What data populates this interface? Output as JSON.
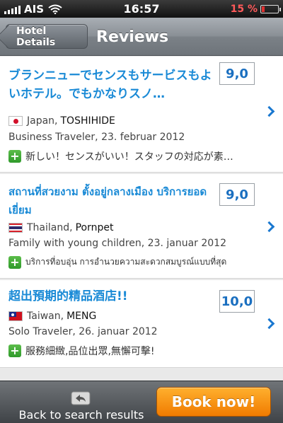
{
  "status_bar": {
    "carrier": "AIS",
    "time": "16:57",
    "battery_percent": "15 %",
    "battery_level": 0.15,
    "icons": [
      "signal-icon",
      "wifi-icon",
      "battery-icon"
    ]
  },
  "nav": {
    "back_label": "Hotel Details",
    "title": "Reviews"
  },
  "reviews": [
    {
      "title": "ブランニューでセンスもサービスもよいホテル。でもかなりスノ…",
      "score": "9,0",
      "country": "Japan,",
      "reviewer": "TOSHIHIDE",
      "flag_icon": "japan-flag-icon",
      "traveler": "Business Traveler, 23. februar 2012",
      "pro": "新しい！センスがいい！スタッフの対応が素…"
    },
    {
      "title": "สถานที่สวยงาม ตั้งอยู่กลางเมือง บริการยอดเยี่ยม",
      "score": "9,0",
      "country": "Thailand,",
      "reviewer": "Pornpet",
      "flag_icon": "thailand-flag-icon",
      "traveler": "Family with young children, 23. januar 2012",
      "pro": "บริการที่อบอุ่น การอำนวยความสะดวกสมบูรณ์แบบที่สุด"
    },
    {
      "title": "超出預期的精品酒店!!",
      "score": "10,0",
      "country": "Taiwan,",
      "reviewer": "MENG",
      "flag_icon": "taiwan-flag-icon",
      "traveler": "Solo Traveler, 26. januar 2012",
      "pro": "服務細緻,品位出眾,無懈可擊!"
    }
  ],
  "bottom_bar": {
    "back_label": "Back to search results",
    "book_label": "Book now!"
  },
  "colors": {
    "link_blue": "#1a8ad6",
    "book_orange": "#f39a12",
    "plus_green": "#3aa832"
  }
}
